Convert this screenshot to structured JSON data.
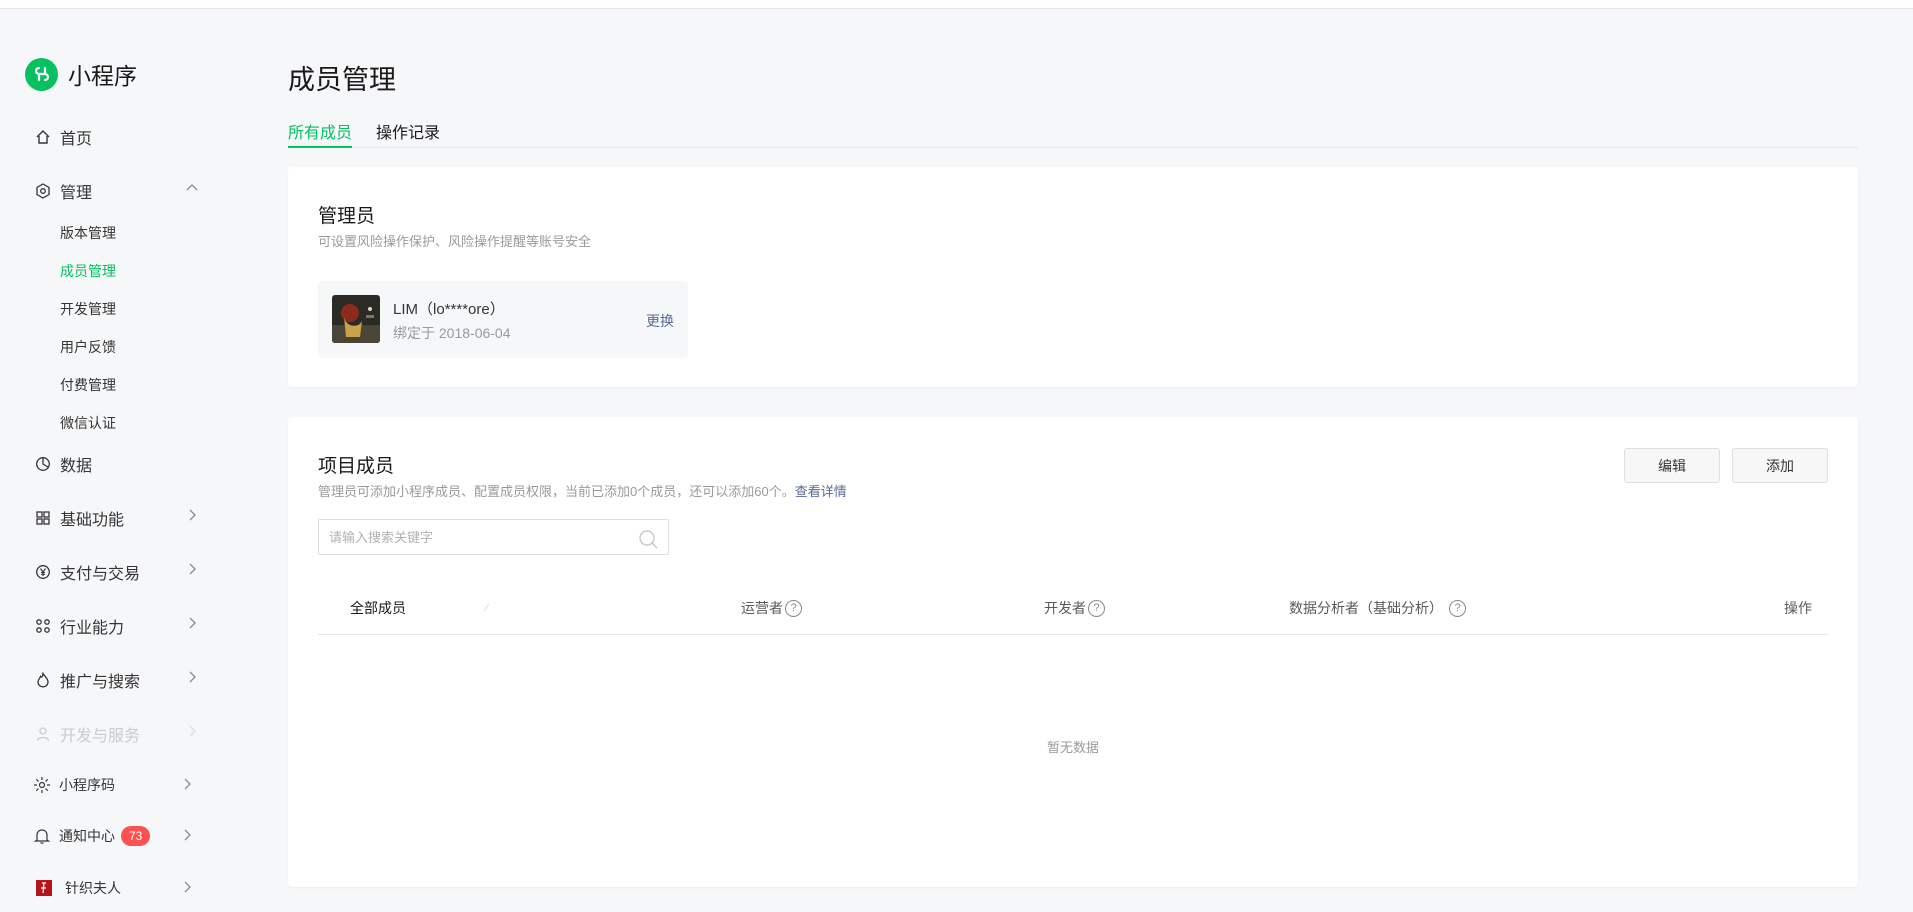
{
  "brand": {
    "name": "小程序",
    "color": "#07c160"
  },
  "sidebar": {
    "home": "首页",
    "manage": "管理",
    "manage_items": [
      "版本管理",
      "成员管理",
      "开发管理",
      "用户反馈",
      "付费管理",
      "微信认证"
    ],
    "active_sub": "成员管理",
    "data": "数据",
    "basic": "基础功能",
    "pay": "支付与交易",
    "industry": "行业能力",
    "promote": "推广与搜索",
    "devservice": "开发与服务",
    "qrcode": "小程序码",
    "notify": "通知中心",
    "notify_count": "73",
    "account": "针织夫人"
  },
  "page": {
    "title": "成员管理"
  },
  "tabs": {
    "all": "所有成员",
    "log": "操作记录"
  },
  "admin": {
    "title": "管理员",
    "desc": "可设置风险操作保护、风险操作提醒等账号安全",
    "name": "LIM（lo****ore）",
    "date": "绑定于 2018-06-04",
    "change": "更换"
  },
  "members": {
    "title": "项目成员",
    "desc": "管理员可添加小程序成员、配置成员权限，当前已添加0个成员，还可以添加60个。",
    "link": "查看详情",
    "edit": "编辑",
    "add": "添加",
    "search_placeholder": "请输入搜索关键字",
    "columns": {
      "all": "全部成员",
      "operator": "运营者",
      "developer": "开发者",
      "analyst": "数据分析者（基础分析）",
      "action": "操作"
    },
    "help_mark": "?",
    "empty": "暂无数据"
  }
}
